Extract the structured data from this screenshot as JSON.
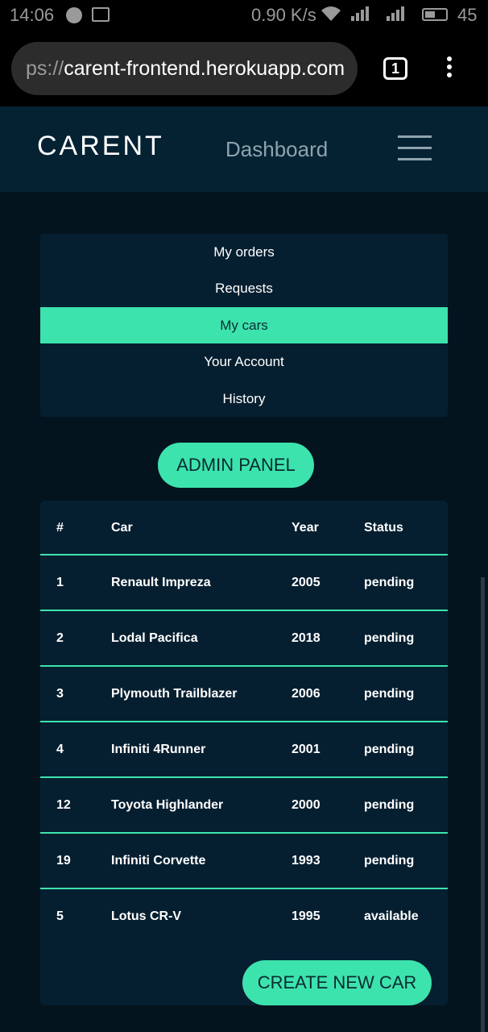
{
  "status_bar": {
    "time": "14:06",
    "speed": "0.90 K/s",
    "battery": "45"
  },
  "browser": {
    "url_scheme": "ps://",
    "url_host": "carent-frontend.herokuapp.com",
    "tab_count": "1"
  },
  "header": {
    "brand": "CARENT",
    "nav_link": "Dashboard"
  },
  "menu": {
    "items": [
      "My orders",
      "Requests",
      "My cars",
      "Your Account",
      "History"
    ],
    "active_index": 2
  },
  "admin_button": "ADMIN PANEL",
  "table": {
    "columns": [
      "#",
      "Car",
      "Year",
      "Status"
    ],
    "rows": [
      [
        "1",
        "Renault Impreza",
        "2005",
        "pending"
      ],
      [
        "2",
        "Lodal Pacifica",
        "2018",
        "pending"
      ],
      [
        "3",
        "Plymouth Trailblazer",
        "2006",
        "pending"
      ],
      [
        "4",
        "Infiniti 4Runner",
        "2001",
        "pending"
      ],
      [
        "12",
        "Toyota Highlander",
        "2000",
        "pending"
      ],
      [
        "19",
        "Infiniti Corvette",
        "1993",
        "pending"
      ],
      [
        "5",
        "Lotus CR-V",
        "1995",
        "available"
      ]
    ]
  },
  "create_button": "CREATE NEW CAR",
  "colors": {
    "accent": "#3de3ad",
    "background": "#04141f",
    "panel": "#061f30",
    "header": "#052233"
  }
}
